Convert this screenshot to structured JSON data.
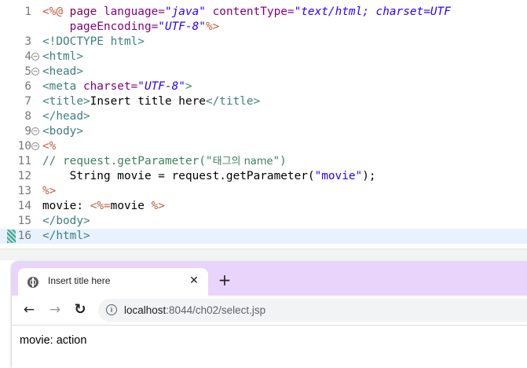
{
  "editor": {
    "lines": [
      {
        "num": "1"
      },
      {
        "num": ""
      },
      {
        "num": "3"
      },
      {
        "num": "4"
      },
      {
        "num": "5"
      },
      {
        "num": "6"
      },
      {
        "num": "7"
      },
      {
        "num": "8"
      },
      {
        "num": "9"
      },
      {
        "num": "10"
      },
      {
        "num": "11"
      },
      {
        "num": "12"
      },
      {
        "num": "13"
      },
      {
        "num": "14"
      },
      {
        "num": "15"
      },
      {
        "num": "16"
      }
    ],
    "tokens": {
      "l1_open": "<%@",
      "l1_page": " page ",
      "l1_lang_attr": "language=",
      "l1_lang_val": "\"java\"",
      "l1_ct_attr": " contentType=",
      "l1_ct_val": "\"text/html; charset=UTF",
      "l2_pe_attr": "    pageEncoding=",
      "l2_pe_val": "\"UTF-8\"",
      "l2_close": "%>",
      "l3": "<!DOCTYPE html>",
      "l4": "<html>",
      "l5": "<head>",
      "l6_open": "<meta ",
      "l6_attr": "charset=",
      "l6_val": "\"UTF-8\"",
      "l6_close": ">",
      "l7_open": "<title>",
      "l7_text": "Insert title here",
      "l7_close": "</title>",
      "l8": "</head>",
      "l9": "<body>",
      "l10": "<%",
      "l11_cmt": "// request.getParameter(\"",
      "l11_kor": "태그의 name",
      "l11_end": "\")",
      "l12_a": "    String movie = request.getParameter(",
      "l12_str": "\"movie\"",
      "l12_b": ");",
      "l13": "%>",
      "l14_a": "movie: ",
      "l14_open": "<%=",
      "l14_b": "movie ",
      "l14_close": "%>",
      "l15": "</body>",
      "l16": "</html>"
    }
  },
  "browser": {
    "tab_title": "Insert title here",
    "tab_close": "✕",
    "new_tab": "+",
    "back": "←",
    "forward": "→",
    "reload": "↻",
    "info": "i",
    "url_host": "localhost",
    "url_path": ":8044/ch02/select.jsp",
    "content": "movie: action",
    "accent_color": "#e9d5fb"
  }
}
